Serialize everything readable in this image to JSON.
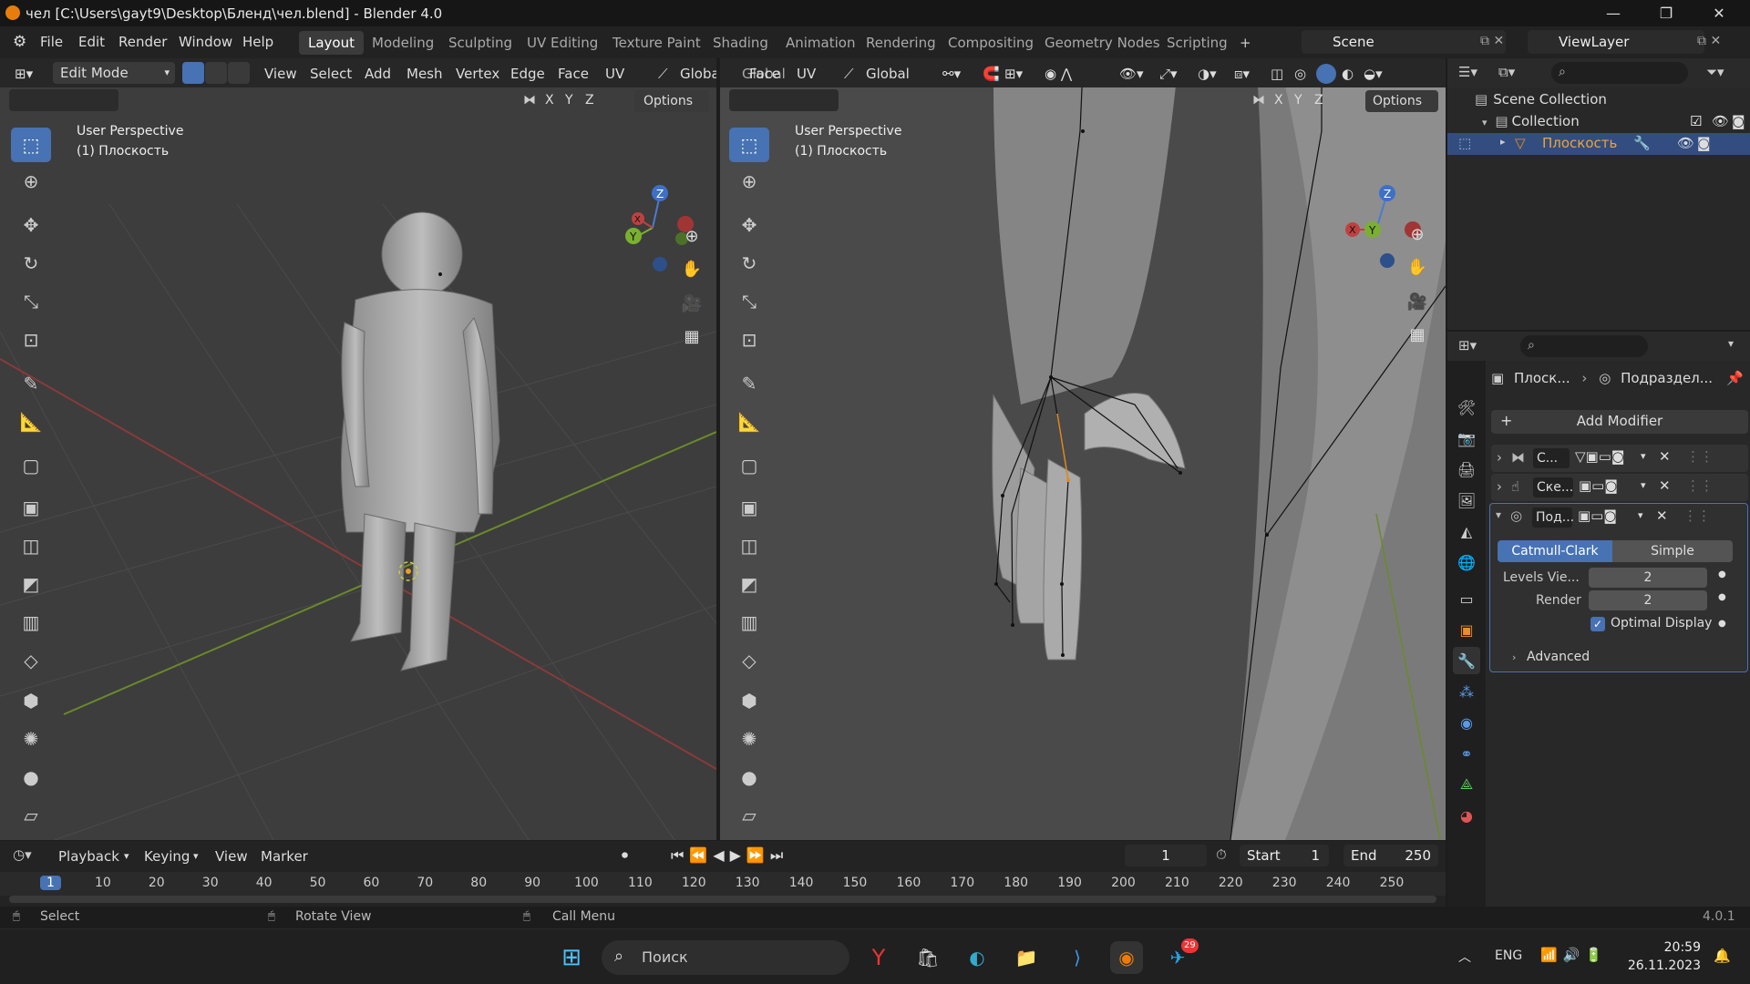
{
  "window": {
    "title": "чел [C:\\Users\\gayt9\\Desktop\\Бленд\\чел.blend] - Blender 4.0"
  },
  "menu": [
    "File",
    "Edit",
    "Render",
    "Window",
    "Help"
  ],
  "workspaces": [
    "Layout",
    "Modeling",
    "Sculpting",
    "UV Editing",
    "Texture Paint",
    "Shading",
    "Animation",
    "Rendering",
    "Compositing",
    "Geometry Nodes",
    "Scripting"
  ],
  "workspace_add": "+",
  "scene": {
    "label": "Scene"
  },
  "viewlayer": {
    "label": "ViewLayer"
  },
  "viewport_left": {
    "mode": "Edit Mode",
    "menus": [
      "View",
      "Select",
      "Add",
      "Mesh",
      "Vertex",
      "Edge",
      "Face",
      "UV"
    ],
    "orientation": "Global",
    "options": "Options",
    "axes": [
      "X",
      "Y",
      "Z"
    ],
    "perspective": "User Perspective",
    "object": "(1) Плоскость"
  },
  "viewport_right": {
    "menus": [
      "Face",
      "UV"
    ],
    "orientation": "Global",
    "options": "Options",
    "axes": [
      "X",
      "Y",
      "Z"
    ],
    "perspective": "User Perspective",
    "object": "(1) Плоскость"
  },
  "outliner": {
    "scene_collection": "Scene Collection",
    "collection": "Collection",
    "object": "Плоскость"
  },
  "properties": {
    "breadcrumb_object": "Плоск...",
    "breadcrumb_modifier": "Подраздел...",
    "add_modifier": "Add Modifier",
    "modifiers": [
      {
        "name": "С..."
      },
      {
        "name": "Ске..."
      },
      {
        "name": "Под..."
      }
    ],
    "subdiv": {
      "catmull": "Catmull-Clark",
      "simple": "Simple",
      "levels_label": "Levels Vie...",
      "levels_value": "2",
      "render_label": "Render",
      "render_value": "2",
      "optimal": "Optimal Display",
      "advanced": "Advanced"
    }
  },
  "timeline": {
    "menus": [
      "Playback",
      "Keying",
      "View",
      "Marker"
    ],
    "current_frame": "1",
    "start_label": "Start",
    "start_value": "1",
    "end_label": "End",
    "end_value": "250",
    "ruler": [
      "1",
      "10",
      "20",
      "30",
      "40",
      "50",
      "60",
      "70",
      "80",
      "90",
      "100",
      "110",
      "120",
      "130",
      "140",
      "150",
      "160",
      "170",
      "180",
      "190",
      "200",
      "210",
      "220",
      "230",
      "240",
      "250"
    ]
  },
  "status": {
    "select": "Select",
    "rotate": "Rotate View",
    "menu": "Call Menu",
    "version": "4.0.1"
  },
  "taskbar": {
    "search": "Поиск",
    "lang": "ENG",
    "time": "20:59",
    "date": "26.11.2023",
    "telegram_badge": "29"
  }
}
